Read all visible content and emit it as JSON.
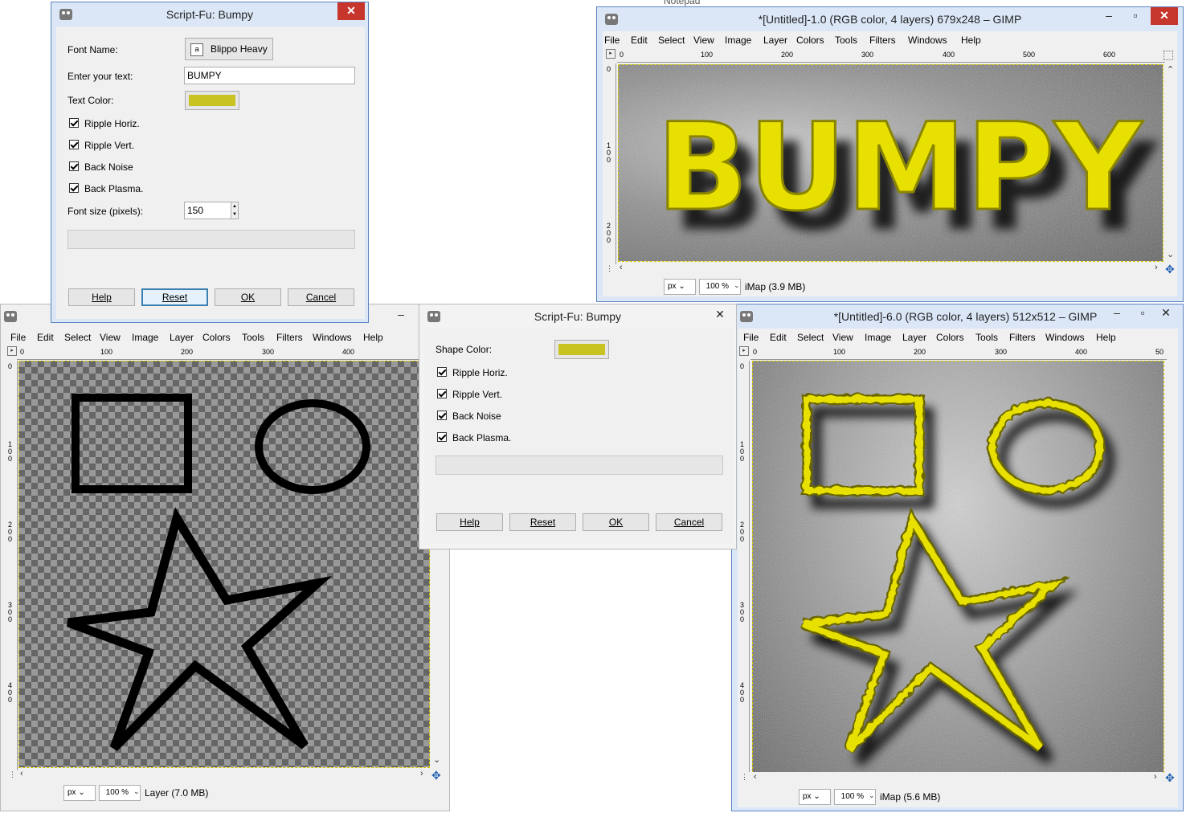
{
  "dialog1": {
    "title": "Script-Fu: Bumpy",
    "font_name_label": "Font Name:",
    "font_name_value": "Blippo Heavy",
    "text_label": "Enter your text:",
    "text_value": "BUMPY",
    "text_color_label": "Text Color:",
    "checkboxes": [
      "Ripple Horiz.",
      "Ripple Vert.",
      "Back Noise",
      "Back Plasma."
    ],
    "font_size_label": "Font size (pixels):",
    "font_size_value": "150",
    "buttons": {
      "help": "Help",
      "reset": "Reset",
      "ok": "OK",
      "cancel": "Cancel"
    },
    "color": "#c8c320"
  },
  "dialog2": {
    "title": "Script-Fu: Bumpy",
    "shape_color_label": "Shape Color:",
    "checkboxes": [
      "Ripple Horiz.",
      "Ripple Vert.",
      "Back Noise",
      "Back Plasma."
    ],
    "buttons": {
      "help": "Help",
      "reset": "Reset",
      "ok": "OK",
      "cancel": "Cancel"
    },
    "color": "#c8c320"
  },
  "menu": [
    "File",
    "Edit",
    "Select",
    "View",
    "Image",
    "Layer",
    "Colors",
    "Tools",
    "Filters",
    "Windows",
    "Help"
  ],
  "gimp1": {
    "title": "*[Untitled]-1.0 (RGB color, 4 layers) 679x248 – GIMP",
    "ruler_ticks": [
      "0",
      "100",
      "200",
      "300",
      "400",
      "500",
      "600"
    ],
    "vruler_ticks": [
      "0",
      "100",
      "200"
    ],
    "canvas_text": "BUMPY",
    "unit": "px",
    "zoom": "100 %",
    "status": "iMap (3.9 MB)"
  },
  "gimp_left": {
    "ruler_ticks": [
      "0",
      "100",
      "200",
      "300",
      "400"
    ],
    "vruler_ticks": [
      "0",
      "100",
      "200",
      "300",
      "400"
    ],
    "unit": "px",
    "zoom": "100 %",
    "status": "Layer (7.0 MB)"
  },
  "gimp6": {
    "title": "*[Untitled]-6.0 (RGB color, 4 layers) 512x512 – GIMP",
    "ruler_ticks": [
      "0",
      "100",
      "200",
      "300",
      "400",
      "50"
    ],
    "vruler_ticks": [
      "0",
      "100",
      "200",
      "300",
      "400"
    ],
    "unit": "px",
    "zoom": "100 %",
    "status": "iMap (5.6 MB)"
  },
  "colors": {
    "yellow": "#e8e000",
    "swatch": "#c8c320",
    "accent": "#5b83c2"
  },
  "background_fragment": "Notepad"
}
